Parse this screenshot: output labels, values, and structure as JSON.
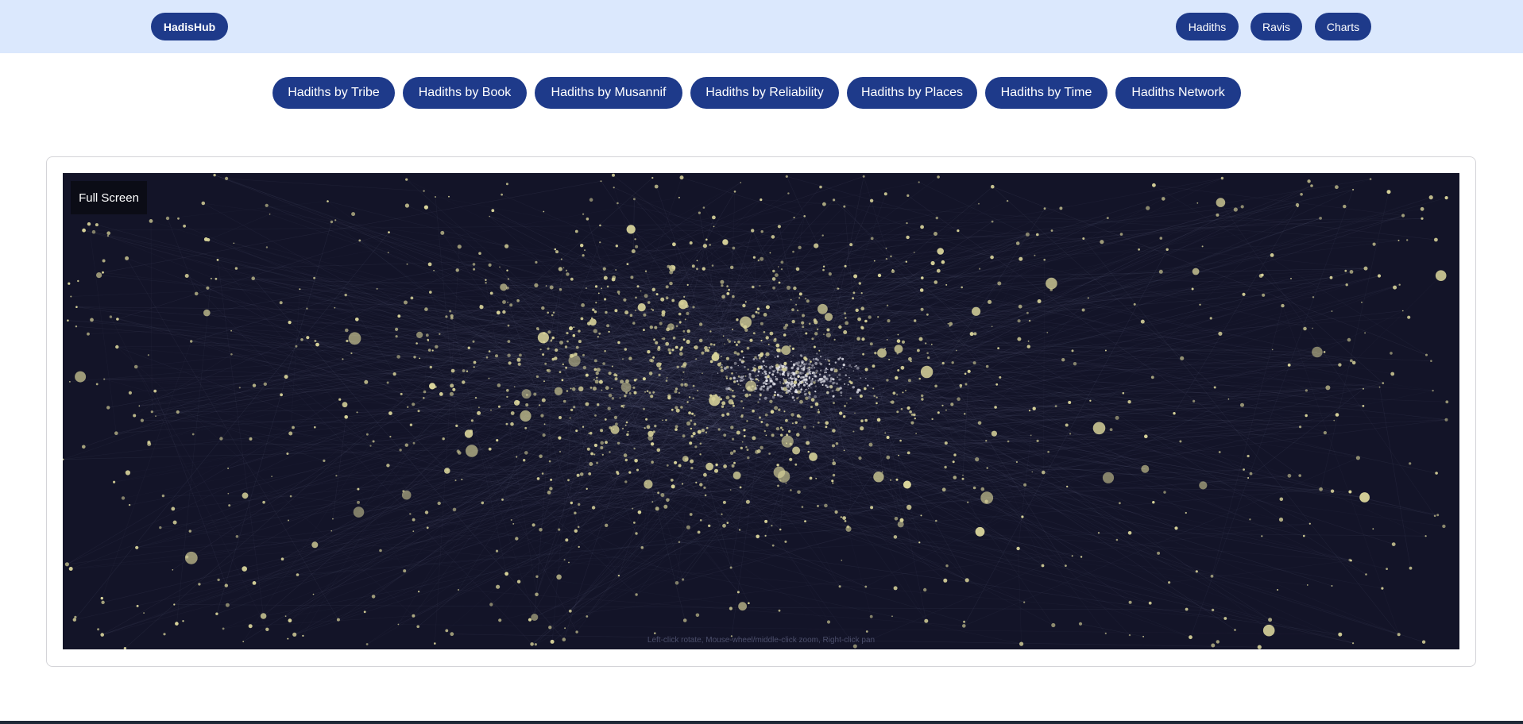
{
  "header": {
    "brand": "HadisHub",
    "nav": [
      {
        "label": "Hadiths"
      },
      {
        "label": "Ravis"
      },
      {
        "label": "Charts"
      }
    ],
    "background_color": "#dbe8fd",
    "accent_color": "#1e3a8a"
  },
  "tabs": [
    {
      "label": "Hadiths by Tribe"
    },
    {
      "label": "Hadiths by Book"
    },
    {
      "label": "Hadiths by Musannif"
    },
    {
      "label": "Hadiths by Reliability"
    },
    {
      "label": "Hadiths by Places"
    },
    {
      "label": "Hadiths by Time"
    },
    {
      "label": "Hadiths Network"
    }
  ],
  "graph": {
    "fullscreen_label": "Full Screen",
    "attribution": "Left-click rotate, Mouse-wheel/middle-click zoom, Right-click pan",
    "background_color": "#131428",
    "node_color": "#d8d39a",
    "edge_color": "#8a8fb0"
  }
}
